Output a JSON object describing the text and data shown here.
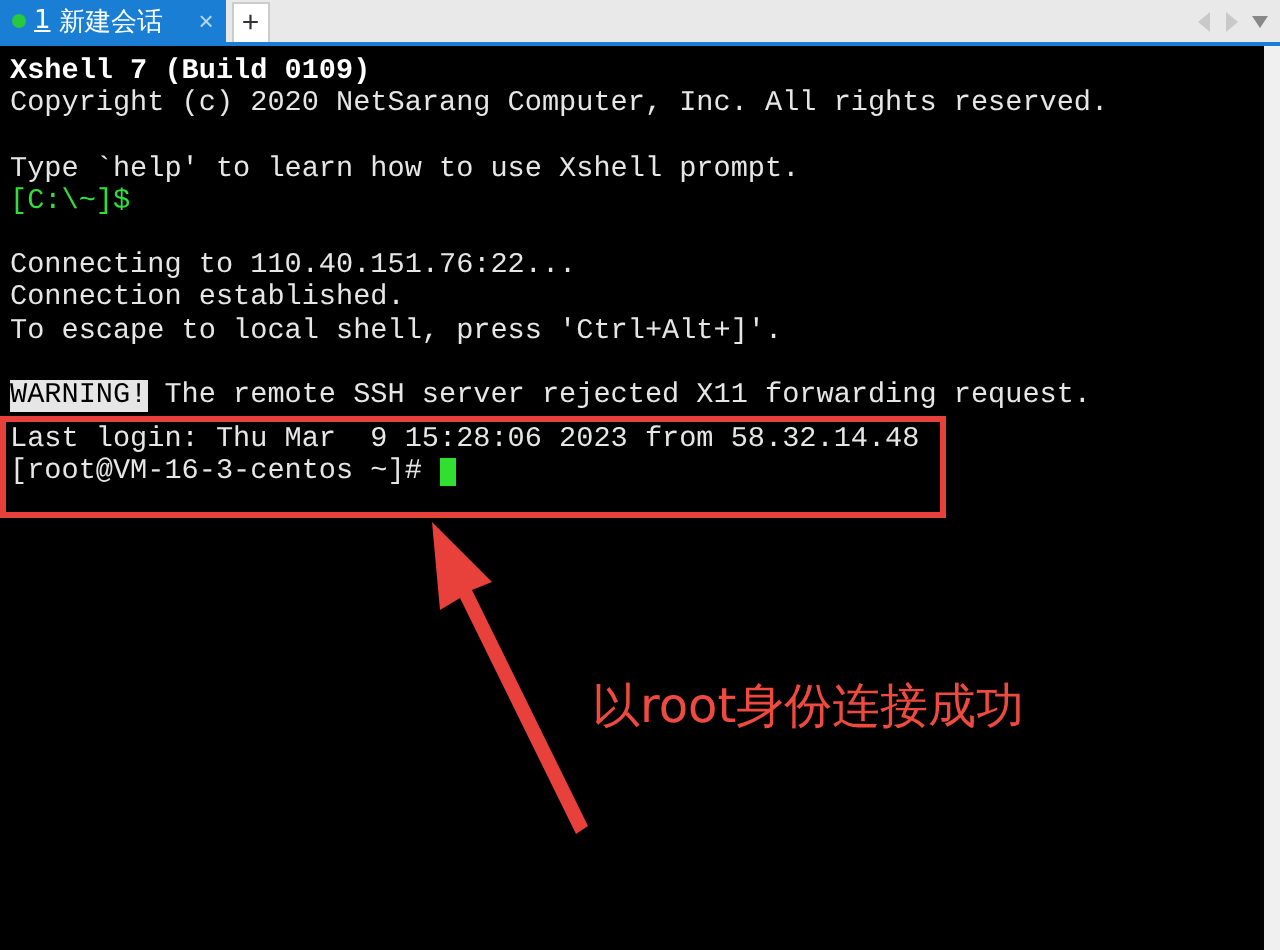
{
  "tabs": [
    {
      "number": "1",
      "label": "新建会话",
      "close": "×",
      "selected": true,
      "connected": true
    }
  ],
  "new_tab": "+",
  "terminal": {
    "lines": [
      {
        "kind": "text",
        "segments": [
          {
            "text": "Xshell 7 (Build 0109)",
            "kind": "bold"
          }
        ]
      },
      {
        "kind": "text",
        "segments": [
          {
            "text": "Copyright (c) 2020 NetSarang Computer, Inc. All rights reserved.",
            "kind": "plain"
          }
        ]
      },
      {
        "kind": "blank"
      },
      {
        "kind": "text",
        "segments": [
          {
            "text": "Type `help' to learn how to use Xshell prompt.",
            "kind": "plain"
          }
        ]
      },
      {
        "kind": "text",
        "segments": [
          {
            "text": "[C:\\~]$",
            "kind": "prompt"
          }
        ]
      },
      {
        "kind": "blank"
      },
      {
        "kind": "text",
        "segments": [
          {
            "text": "Connecting to 110.40.151.76:22...",
            "kind": "plain"
          }
        ]
      },
      {
        "kind": "text",
        "segments": [
          {
            "text": "Connection established.",
            "kind": "plain"
          }
        ]
      },
      {
        "kind": "text",
        "segments": [
          {
            "text": "To escape to local shell, press 'Ctrl+Alt+]'.",
            "kind": "plain"
          }
        ]
      },
      {
        "kind": "blank"
      },
      {
        "kind": "text",
        "segments": [
          {
            "text": "WARNING!",
            "kind": "inverse"
          },
          {
            "text": " The remote SSH server rejected X11 forwarding request.",
            "kind": "plain"
          }
        ]
      },
      {
        "kind": "text",
        "highlighted": true,
        "segments": [
          {
            "text": "Last login: Thu Mar  9 15:28:06 2023 from 58.32.14.48",
            "kind": "plain"
          }
        ]
      },
      {
        "kind": "text",
        "highlighted": true,
        "cursor": true,
        "segments": [
          {
            "text": "[root@VM-16-3-centos ~]#",
            "kind": "plain"
          }
        ]
      }
    ]
  },
  "annotation": {
    "text": "以root身份连接成功"
  }
}
